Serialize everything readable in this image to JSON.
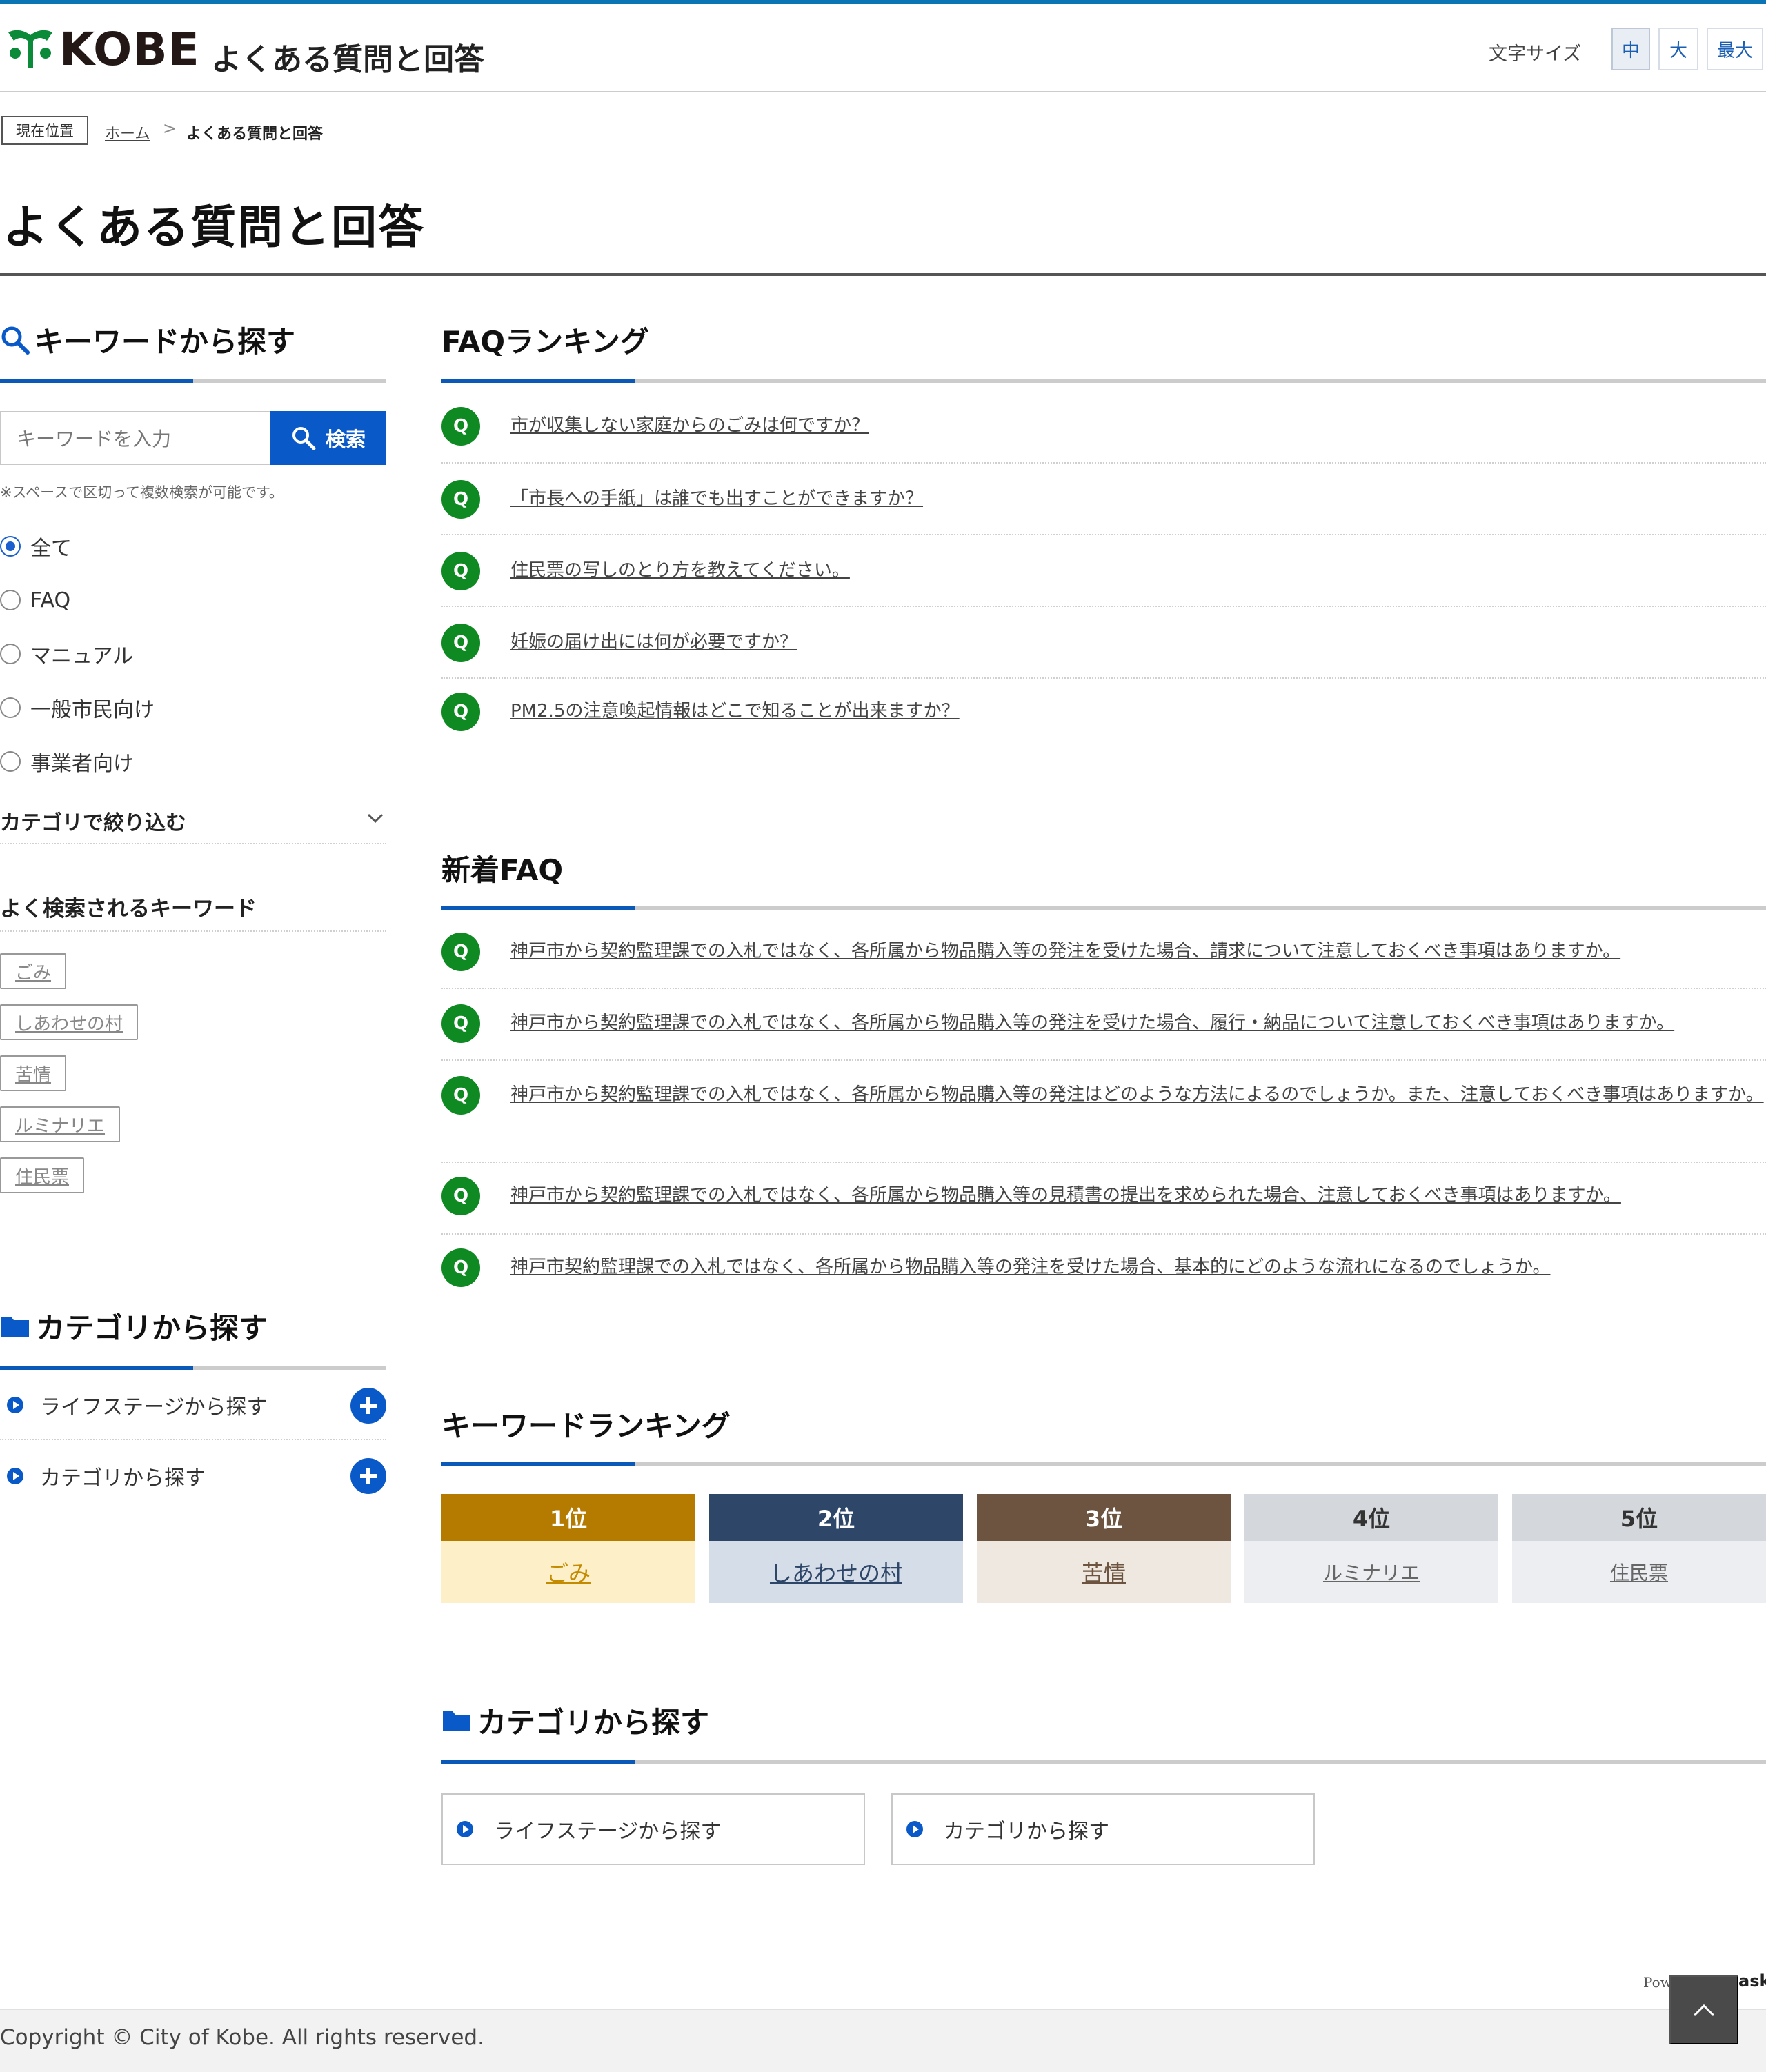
{
  "header": {
    "logo_text": "KOBE",
    "site_title": "よくある質問と回答",
    "font_size_label": "文字サイズ",
    "font_sizes": [
      "中",
      "大",
      "最大"
    ],
    "font_size_selected": "中"
  },
  "breadcrumb": {
    "label": "現在位置",
    "home": "ホーム",
    "separator": ">",
    "current": "よくある質問と回答"
  },
  "page_title": "よくある質問と回答",
  "keyword_search": {
    "heading": "キーワードから探す",
    "placeholder": "キーワードを入力",
    "button": "検索",
    "note": "※スペースで区切って複数検索が可能です。",
    "options": [
      "全て",
      "FAQ",
      "マニュアル",
      "一般市民向け",
      "事業者向け"
    ],
    "selected": "全て",
    "category_filter": "カテゴリで絞り込む",
    "popular_heading": "よく検索されるキーワード",
    "popular": [
      "ごみ",
      "しあわせの村",
      "苦情",
      "ルミナリエ",
      "住民票"
    ]
  },
  "category_left": {
    "heading": "カテゴリから探す",
    "items": [
      "ライフステージから探す",
      "カテゴリから探す"
    ]
  },
  "faq_ranking": {
    "heading": "FAQランキング",
    "badge": "Q",
    "items": [
      "市が収集しない家庭からのごみは何ですか？",
      "「市長への手紙」は誰でも出すことができますか？",
      "住民票の写しのとり方を教えてください。",
      "妊娠の届け出には何が必要ですか？",
      "PM2.5の注意喚起情報はどこで知ることが出来ますか？"
    ]
  },
  "new_faq": {
    "heading": "新着FAQ",
    "badge": "Q",
    "items": [
      "神戸市から契約監理課での入札ではなく、各所属から物品購入等の発注を受けた場合、請求について注意しておくべき事項はありますか。",
      "神戸市から契約監理課での入札ではなく、各所属から物品購入等の発注を受けた場合、履行・納品について注意しておくべき事項はありますか。",
      "神戸市から契約監理課での入札ではなく、各所属から物品購入等の発注はどのような方法によるのでしょうか。また、注意しておくべき事項はありますか。",
      "神戸市から契約監理課での入札ではなく、各所属から物品購入等の見積書の提出を求められた場合、注意しておくべき事項はありますか。",
      "神戸市契約監理課での入札ではなく、各所属から物品購入等の発注を受けた場合、基本的にどのような流れになるのでしょうか。"
    ]
  },
  "keyword_ranking": {
    "heading": "キーワードランキング",
    "items": [
      {
        "rank": "1位",
        "word": "ごみ",
        "top": "#b57a00",
        "bottom": "#fdf0c8",
        "text": "#c48a00",
        "rank_text": "#ffffff"
      },
      {
        "rank": "2位",
        "word": "しあわせの村",
        "top": "#2e4667",
        "bottom": "#d5dde9",
        "text": "#2e4667",
        "rank_text": "#ffffff"
      },
      {
        "rank": "3位",
        "word": "苦情",
        "top": "#6d5440",
        "bottom": "#efe8e0",
        "text": "#6d5440",
        "rank_text": "#ffffff"
      },
      {
        "rank": "4位",
        "word": "ルミナリエ",
        "top": "#d4d8dd",
        "bottom": "#eceef1",
        "text": "#666666",
        "rank_text": "#333333"
      },
      {
        "rank": "5位",
        "word": "住民票",
        "top": "#d4d8dd",
        "bottom": "#eceef1",
        "text": "#666666",
        "rank_text": "#333333"
      }
    ]
  },
  "category_main": {
    "heading": "カテゴリから探す",
    "items": [
      "ライフステージから探す",
      "カテゴリから探す"
    ]
  },
  "footer": {
    "powered_prefix": "Pow",
    "powered_suffix": "ask",
    "copyright": "Copyright © City of Kobe. All rights reserved."
  },
  "colors": {
    "accent_blue": "#0a59b8",
    "q_badge_green": "#0f8a22",
    "top_bar": "#0a74b5"
  }
}
